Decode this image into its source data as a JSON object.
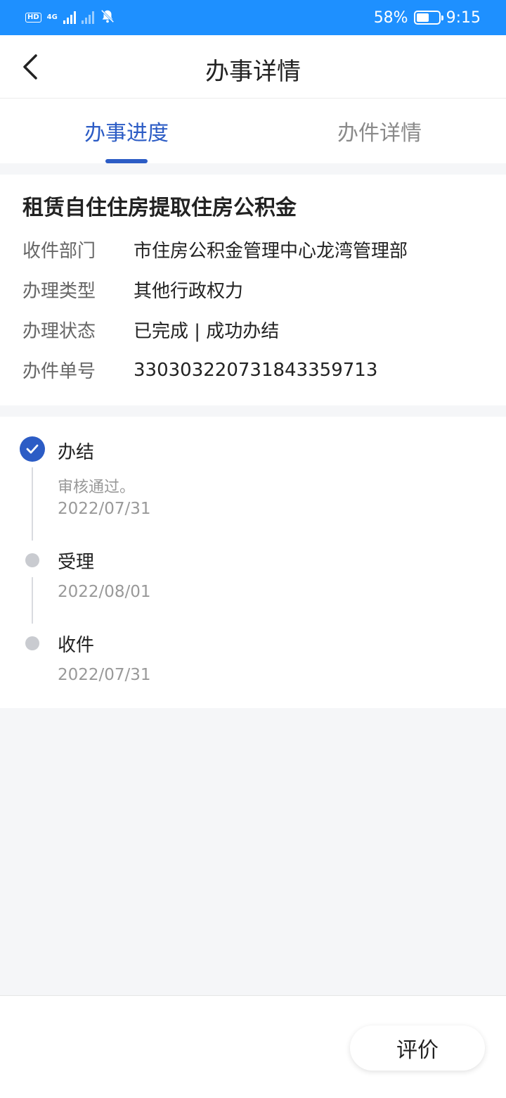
{
  "status_bar": {
    "hd_label": "HD",
    "network_label": "4G",
    "battery_percent": "58%",
    "battery_level": 0.58,
    "time": "9:15"
  },
  "header": {
    "title": "办事详情"
  },
  "tabs": [
    {
      "label": "办事进度",
      "active": true
    },
    {
      "label": "办件详情",
      "active": false
    }
  ],
  "case": {
    "title": "租赁自住住房提取住房公积金",
    "fields": [
      {
        "label": "收件部门",
        "value": "市住房公积金管理中心龙湾管理部"
      },
      {
        "label": "办理类型",
        "value": "其他行政权力"
      },
      {
        "label": "办理状态",
        "value": "已完成 | 成功办结"
      },
      {
        "label": "办件单号",
        "value": "330303220731843359713"
      }
    ]
  },
  "timeline": [
    {
      "title": "办结",
      "desc": "审核通过。",
      "date": "2022/07/31",
      "done": true
    },
    {
      "title": "受理",
      "desc": "",
      "date": "2022/08/01",
      "done": false
    },
    {
      "title": "收件",
      "desc": "",
      "date": "2022/07/31",
      "done": false
    }
  ],
  "bottom": {
    "rate_label": "评价"
  },
  "colors": {
    "status_bar": "#1e90ff",
    "accent": "#2c5cc5",
    "inactive_node": "#c9cbd0"
  }
}
